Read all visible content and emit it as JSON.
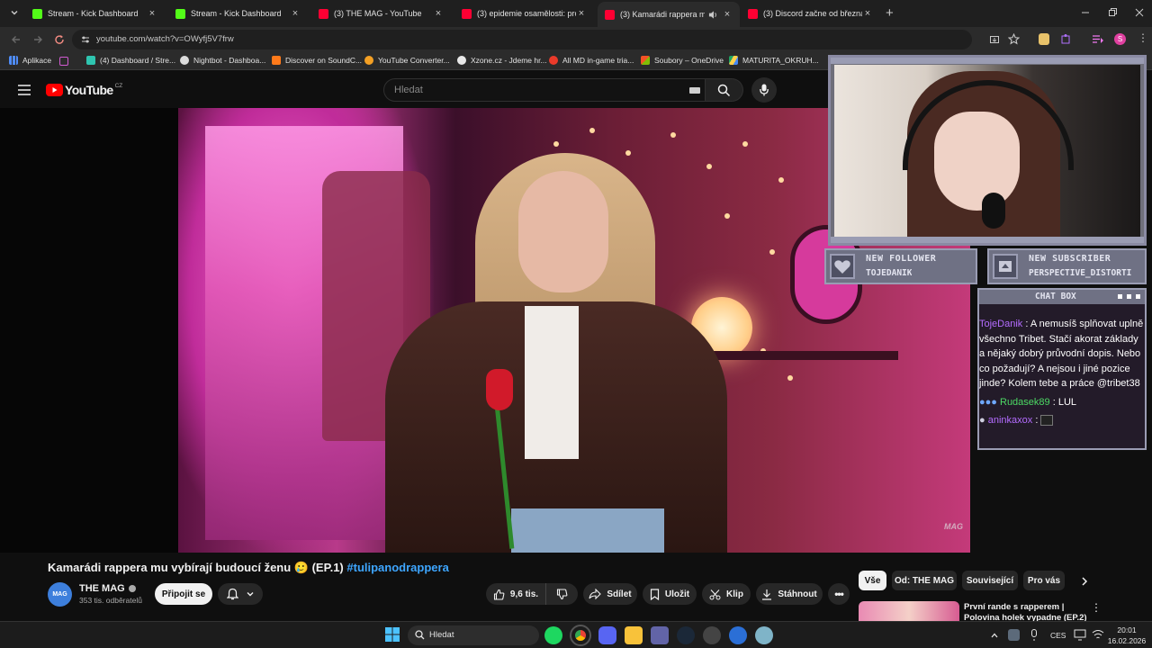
{
  "browser": {
    "tabs": [
      {
        "title": "Stream - Kick Dashboard",
        "icon": "kick-icon"
      },
      {
        "title": "Stream - Kick Dashboard",
        "icon": "kick-icon"
      },
      {
        "title": "(3) THE MAG - YouTube",
        "icon": "youtube-icon"
      },
      {
        "title": "(3) epidemie osamělosti: proč s",
        "icon": "youtube-icon"
      },
      {
        "title": "(3) Kamarádi rappera mu vy",
        "icon": "youtube-icon"
      },
      {
        "title": "(3) Discord začne od března ov",
        "icon": "youtube-icon"
      }
    ],
    "url": "youtube.com/watch?v=OWyfj5V7frw",
    "bookmarks": [
      "Aplikace",
      "(4) Dashboard / Stre...",
      "Nightbot - Dashboa...",
      "Discover on SoundC...",
      "YouTube Converter...",
      "Xzone.cz - Jdeme hr...",
      "All MD in-game tria...",
      "Soubory – OneDrive",
      "MATURITA_OKRUH..."
    ]
  },
  "youtube": {
    "logo_text": "YouTube",
    "country_code": "CZ",
    "search_placeholder": "Hledat",
    "video_watermark": "MAG",
    "video_title": "Kamarádi rappera mu vybírají budoucí ženu 🥲 (EP.1)",
    "video_hashtag": "#tulipanodrappera",
    "channel_name": "THE MAG",
    "channel_avatar_text": "MAG",
    "subscribers": "353 tis. odběratelů",
    "join_label": "Připojit se",
    "likes": "9,6 tis.",
    "share_label": "Sdílet",
    "save_label": "Uložit",
    "clip_label": "Klip",
    "download_label": "Stáhnout",
    "chips": [
      "Vše",
      "Od: THE MAG",
      "Související",
      "Pro vás"
    ],
    "related_title": "První rande s rapperem | Polovina holek vypadne (EP.2)"
  },
  "overlay": {
    "new_follower_label": "NEW FOLLOWER",
    "new_follower_name": "TOJEDANIK",
    "new_subscriber_label": "NEW SUBSCRIBER",
    "new_subscriber_name": "PERSPECTIVE_DISTORTI",
    "chat_title": "CHAT BOX",
    "chat_messages": [
      {
        "user": "TojeDanik",
        "text": "A nemusíš splňovat uplně všechno Tribet. Stačí akorat základy a nějaký dobrý průvodní dopis. Nebo co požadují? A nejsou i jiné pozice jinde? Kolem tebe a práce @tribet38",
        "user_color": "#b46cff"
      },
      {
        "user": "Rudasek89",
        "text": "LUL",
        "user_color": "#4cd964"
      },
      {
        "user": "aninkaxox",
        "text": "",
        "user_color": "#b46cff"
      }
    ]
  },
  "taskbar": {
    "search_placeholder": "Hledat",
    "language": "CES",
    "time": "20:01",
    "date": "16.02.2026"
  }
}
